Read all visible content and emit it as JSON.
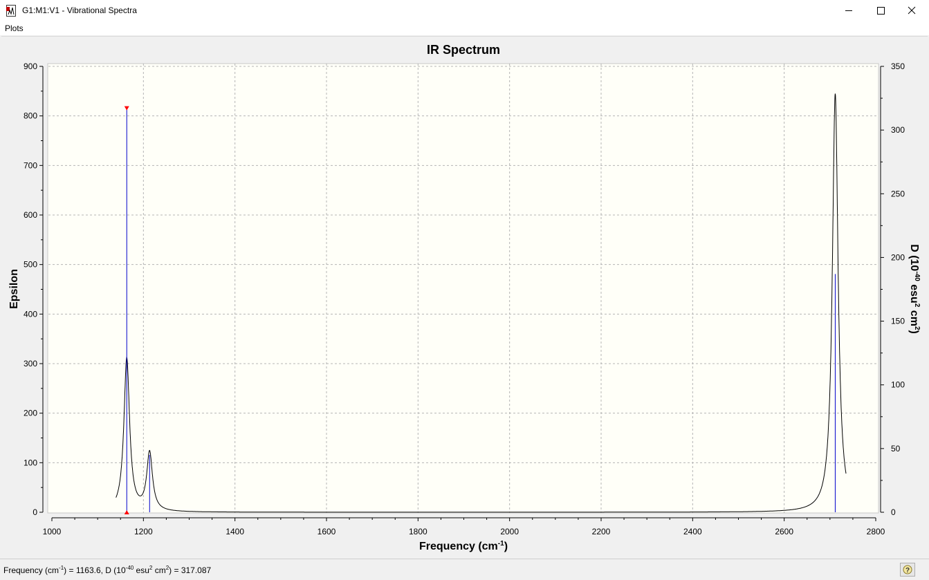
{
  "window": {
    "title": "G1:M1:V1 - Vibrational Spectra",
    "icon": "spectrum-document-icon",
    "controls": [
      "minimize-icon",
      "maximize-icon",
      "close-icon"
    ]
  },
  "menu": {
    "items": [
      "Plots"
    ]
  },
  "status": {
    "text_pre": "Frequency (cm",
    "text_sup1": "-1",
    "text_mid1": ") = 1163.6, D (10",
    "text_sup2": "-40",
    "text_mid2": " esu",
    "text_sup3": "2",
    "text_mid3": " cm",
    "text_sup4": "2",
    "text_post": ") = 317.087",
    "help_icon": "help-icon"
  },
  "colors": {
    "plot_background": "#fffff8",
    "spectrum_line": "#000000",
    "stick_line": "#0000cc",
    "marker": "#ff0000"
  },
  "chart_data": {
    "type": "line",
    "title": "IR Spectrum",
    "xlabel": "Frequency (cm-1)",
    "xlabel_parts": [
      "Frequency (cm",
      "-1",
      ")"
    ],
    "ylabel": "Epsilon",
    "y2label": "D (10-40 esu2 cm2)",
    "y2label_parts": [
      "D (10",
      "-40",
      " esu",
      "2",
      " cm",
      "2",
      ")"
    ],
    "xlim": [
      1000,
      2800
    ],
    "ylim": [
      0,
      900
    ],
    "y2lim": [
      0,
      350
    ],
    "grid": true,
    "xticks": [
      1000,
      1200,
      1400,
      1600,
      1800,
      2000,
      2200,
      2400,
      2600,
      2800
    ],
    "yticks": [
      0,
      100,
      200,
      300,
      400,
      500,
      600,
      700,
      800,
      900
    ],
    "y2ticks": [
      0,
      50,
      100,
      150,
      200,
      250,
      300,
      350
    ],
    "series": [
      {
        "kind": "spectrum",
        "axis": "left",
        "peaks": [
          {
            "center": 1163.6,
            "height": 310
          },
          {
            "center": 1213.5,
            "height": 118
          },
          {
            "center": 2711.5,
            "height": 845
          }
        ],
        "range": [
          1140,
          2735
        ]
      },
      {
        "kind": "sticks",
        "axis": "right",
        "x": [
          1163.6,
          1213.5,
          2711.5
        ],
        "values": [
          317.087,
          45,
          187
        ]
      }
    ],
    "selected": {
      "x": 1163.6,
      "value": 317.087
    }
  }
}
